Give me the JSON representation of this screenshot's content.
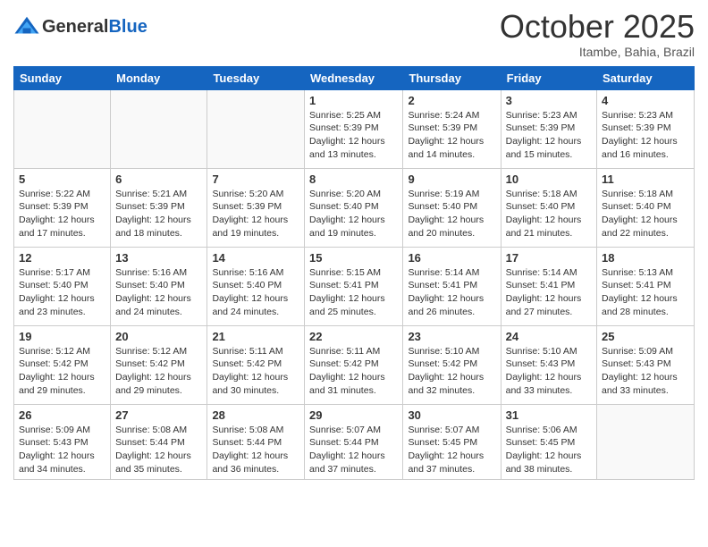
{
  "header": {
    "logo_general": "General",
    "logo_blue": "Blue",
    "month": "October 2025",
    "location": "Itambe, Bahia, Brazil"
  },
  "days_of_week": [
    "Sunday",
    "Monday",
    "Tuesday",
    "Wednesday",
    "Thursday",
    "Friday",
    "Saturday"
  ],
  "weeks": [
    [
      {
        "day": "",
        "info": ""
      },
      {
        "day": "",
        "info": ""
      },
      {
        "day": "",
        "info": ""
      },
      {
        "day": "1",
        "info": "Sunrise: 5:25 AM\nSunset: 5:39 PM\nDaylight: 12 hours\nand 13 minutes."
      },
      {
        "day": "2",
        "info": "Sunrise: 5:24 AM\nSunset: 5:39 PM\nDaylight: 12 hours\nand 14 minutes."
      },
      {
        "day": "3",
        "info": "Sunrise: 5:23 AM\nSunset: 5:39 PM\nDaylight: 12 hours\nand 15 minutes."
      },
      {
        "day": "4",
        "info": "Sunrise: 5:23 AM\nSunset: 5:39 PM\nDaylight: 12 hours\nand 16 minutes."
      }
    ],
    [
      {
        "day": "5",
        "info": "Sunrise: 5:22 AM\nSunset: 5:39 PM\nDaylight: 12 hours\nand 17 minutes."
      },
      {
        "day": "6",
        "info": "Sunrise: 5:21 AM\nSunset: 5:39 PM\nDaylight: 12 hours\nand 18 minutes."
      },
      {
        "day": "7",
        "info": "Sunrise: 5:20 AM\nSunset: 5:39 PM\nDaylight: 12 hours\nand 19 minutes."
      },
      {
        "day": "8",
        "info": "Sunrise: 5:20 AM\nSunset: 5:40 PM\nDaylight: 12 hours\nand 19 minutes."
      },
      {
        "day": "9",
        "info": "Sunrise: 5:19 AM\nSunset: 5:40 PM\nDaylight: 12 hours\nand 20 minutes."
      },
      {
        "day": "10",
        "info": "Sunrise: 5:18 AM\nSunset: 5:40 PM\nDaylight: 12 hours\nand 21 minutes."
      },
      {
        "day": "11",
        "info": "Sunrise: 5:18 AM\nSunset: 5:40 PM\nDaylight: 12 hours\nand 22 minutes."
      }
    ],
    [
      {
        "day": "12",
        "info": "Sunrise: 5:17 AM\nSunset: 5:40 PM\nDaylight: 12 hours\nand 23 minutes."
      },
      {
        "day": "13",
        "info": "Sunrise: 5:16 AM\nSunset: 5:40 PM\nDaylight: 12 hours\nand 24 minutes."
      },
      {
        "day": "14",
        "info": "Sunrise: 5:16 AM\nSunset: 5:40 PM\nDaylight: 12 hours\nand 24 minutes."
      },
      {
        "day": "15",
        "info": "Sunrise: 5:15 AM\nSunset: 5:41 PM\nDaylight: 12 hours\nand 25 minutes."
      },
      {
        "day": "16",
        "info": "Sunrise: 5:14 AM\nSunset: 5:41 PM\nDaylight: 12 hours\nand 26 minutes."
      },
      {
        "day": "17",
        "info": "Sunrise: 5:14 AM\nSunset: 5:41 PM\nDaylight: 12 hours\nand 27 minutes."
      },
      {
        "day": "18",
        "info": "Sunrise: 5:13 AM\nSunset: 5:41 PM\nDaylight: 12 hours\nand 28 minutes."
      }
    ],
    [
      {
        "day": "19",
        "info": "Sunrise: 5:12 AM\nSunset: 5:42 PM\nDaylight: 12 hours\nand 29 minutes."
      },
      {
        "day": "20",
        "info": "Sunrise: 5:12 AM\nSunset: 5:42 PM\nDaylight: 12 hours\nand 29 minutes."
      },
      {
        "day": "21",
        "info": "Sunrise: 5:11 AM\nSunset: 5:42 PM\nDaylight: 12 hours\nand 30 minutes."
      },
      {
        "day": "22",
        "info": "Sunrise: 5:11 AM\nSunset: 5:42 PM\nDaylight: 12 hours\nand 31 minutes."
      },
      {
        "day": "23",
        "info": "Sunrise: 5:10 AM\nSunset: 5:42 PM\nDaylight: 12 hours\nand 32 minutes."
      },
      {
        "day": "24",
        "info": "Sunrise: 5:10 AM\nSunset: 5:43 PM\nDaylight: 12 hours\nand 33 minutes."
      },
      {
        "day": "25",
        "info": "Sunrise: 5:09 AM\nSunset: 5:43 PM\nDaylight: 12 hours\nand 33 minutes."
      }
    ],
    [
      {
        "day": "26",
        "info": "Sunrise: 5:09 AM\nSunset: 5:43 PM\nDaylight: 12 hours\nand 34 minutes."
      },
      {
        "day": "27",
        "info": "Sunrise: 5:08 AM\nSunset: 5:44 PM\nDaylight: 12 hours\nand 35 minutes."
      },
      {
        "day": "28",
        "info": "Sunrise: 5:08 AM\nSunset: 5:44 PM\nDaylight: 12 hours\nand 36 minutes."
      },
      {
        "day": "29",
        "info": "Sunrise: 5:07 AM\nSunset: 5:44 PM\nDaylight: 12 hours\nand 37 minutes."
      },
      {
        "day": "30",
        "info": "Sunrise: 5:07 AM\nSunset: 5:45 PM\nDaylight: 12 hours\nand 37 minutes."
      },
      {
        "day": "31",
        "info": "Sunrise: 5:06 AM\nSunset: 5:45 PM\nDaylight: 12 hours\nand 38 minutes."
      },
      {
        "day": "",
        "info": ""
      }
    ]
  ]
}
